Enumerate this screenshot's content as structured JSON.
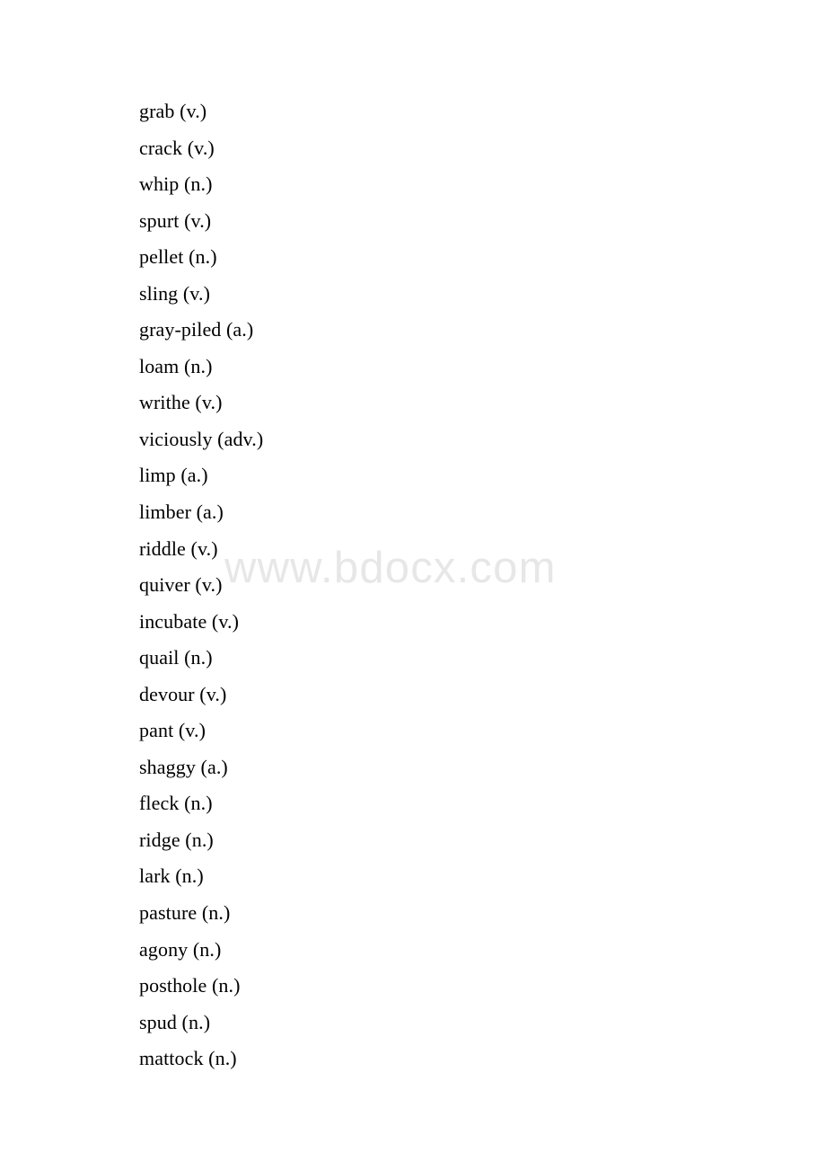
{
  "page": {
    "background_color": "#ffffff",
    "text_color": "#000000",
    "document_type": "vocabulary-word-list"
  },
  "watermark": {
    "text": "www.bdocx.com",
    "color": "#e7e7e7"
  },
  "word_list": {
    "items": [
      {
        "text": "grab (v.)"
      },
      {
        "text": "crack (v.)"
      },
      {
        "text": "whip (n.)"
      },
      {
        "text": "spurt (v.)"
      },
      {
        "text": "pellet (n.)"
      },
      {
        "text": "sling (v.)"
      },
      {
        "text": "gray-piled (a.)"
      },
      {
        "text": "loam (n.)"
      },
      {
        "text": "writhe (v.)"
      },
      {
        "text": "viciously (adv.)"
      },
      {
        "text": "limp (a.)"
      },
      {
        "text": "limber (a.)"
      },
      {
        "text": "riddle (v.)"
      },
      {
        "text": "quiver (v.)"
      },
      {
        "text": "incubate (v.)"
      },
      {
        "text": "quail (n.)"
      },
      {
        "text": "devour (v.)"
      },
      {
        "text": "pant (v.)"
      },
      {
        "text": "shaggy (a.)"
      },
      {
        "text": "fleck (n.)"
      },
      {
        "text": "ridge (n.)"
      },
      {
        "text": "lark (n.)"
      },
      {
        "text": "pasture (n.)"
      },
      {
        "text": "agony (n.)"
      },
      {
        "text": "posthole (n.)"
      },
      {
        "text": "spud (n.)"
      },
      {
        "text": "mattock (n.)"
      }
    ]
  }
}
